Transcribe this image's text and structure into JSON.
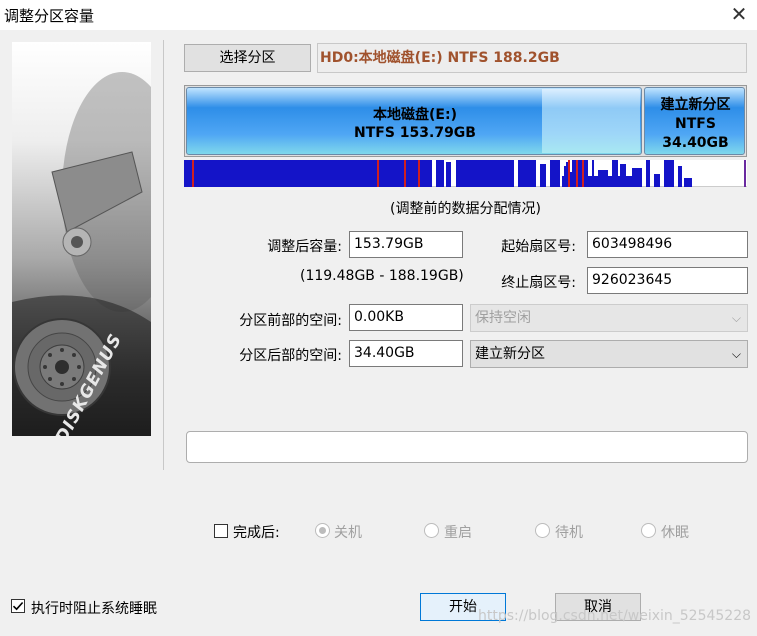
{
  "window": {
    "title": "调整分区容量",
    "close_glyph": "✕"
  },
  "brand": {
    "logo_text": "DISKGENUS"
  },
  "select_partition": {
    "button_label": "选择分区",
    "disk_label": "HD0:本地磁盘(E:) NTFS 188.2GB"
  },
  "partition_bar": {
    "partitions": [
      {
        "name": "本地磁盘(E:)",
        "fs": "NTFS 153.79GB"
      },
      {
        "name": "建立新分区",
        "fs": "NTFS",
        "size": "34.40GB"
      }
    ]
  },
  "distribution_caption": "(调整前的数据分配情况)",
  "form": {
    "new_size_label": "调整后容量:",
    "new_size_value": "153.79GB",
    "range_text": "(119.48GB - 188.19GB)",
    "start_sector_label": "起始扇区号:",
    "start_sector_value": "603498496",
    "end_sector_label": "终止扇区号:",
    "end_sector_value": "926023645",
    "space_before_label": "分区前部的空间:",
    "space_before_value": "0.00KB",
    "space_before_action": "保持空闲",
    "space_after_label": "分区后部的空间:",
    "space_after_value": "34.40GB",
    "space_after_action": "建立新分区"
  },
  "completion": {
    "label": "完成后:",
    "options": [
      "关机",
      "重启",
      "待机",
      "休眠"
    ],
    "selected": "关机"
  },
  "footer": {
    "prevent_sleep_label": "执行时阻止系统睡眠",
    "start_button": "开始",
    "cancel_button": "取消",
    "watermark": "https://blog.csdn.net/weixin_52545228"
  },
  "colors": {
    "accent": "#0078d7",
    "disk_label_text": "#a0522d",
    "partition_blue": "#2e8ee8"
  }
}
